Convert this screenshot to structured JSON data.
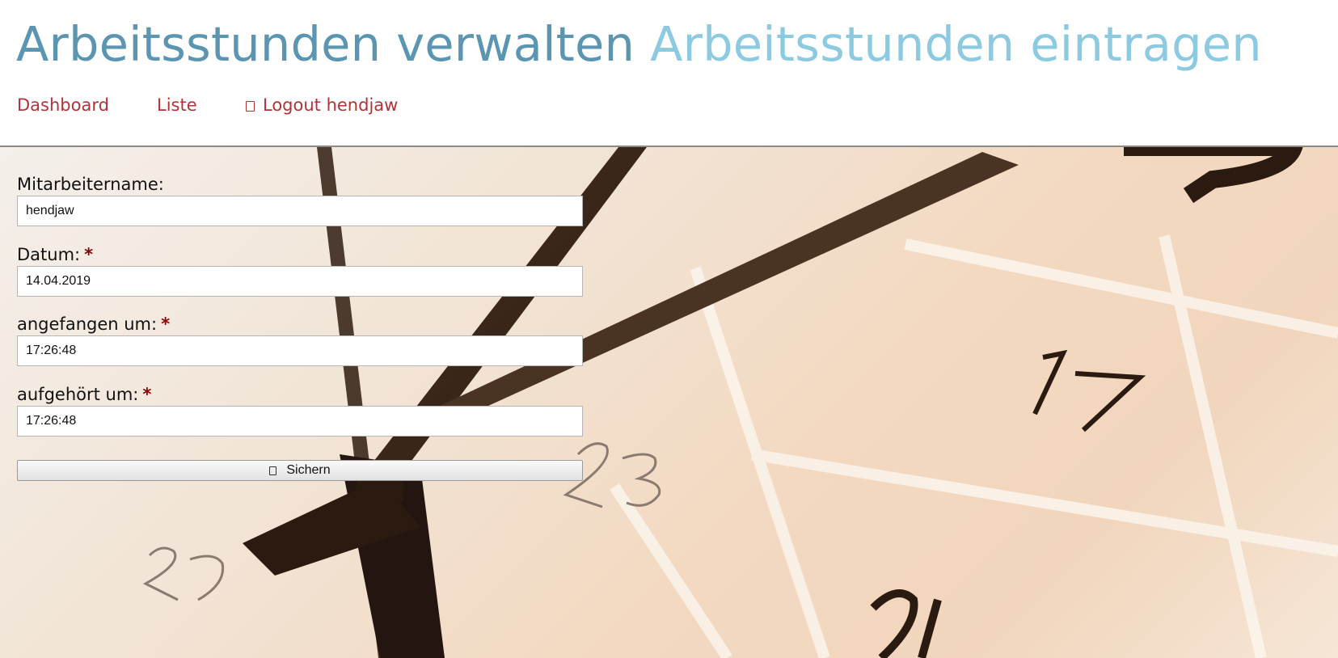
{
  "header": {
    "title_main": "Arbeitsstunden verwalten",
    "title_sub": "Arbeitsstunden eintragen",
    "title_main_color": "#5a95b1",
    "title_sub_color": "#8ccae2"
  },
  "nav": {
    "dashboard": "Dashboard",
    "liste": "Liste",
    "logout": "Logout hendjaw",
    "logout_icon": "logout-icon",
    "link_color": "#b43237"
  },
  "form": {
    "fields": [
      {
        "label": "Mitarbeitername:",
        "required": false,
        "value": "hendjaw"
      },
      {
        "label": "Datum:",
        "required": true,
        "value": "14.04.2019"
      },
      {
        "label": "angefangen um:",
        "required": true,
        "value": "17:26:48"
      },
      {
        "label": "aufgehört um:",
        "required": true,
        "value": "17:26:48"
      }
    ],
    "required_marker": "*",
    "required_color": "#8b0000",
    "submit_label": "Sichern",
    "submit_icon": "save-icon"
  },
  "background": {
    "clock_numbers": [
      "2",
      "17",
      "23",
      "29",
      "24"
    ]
  }
}
